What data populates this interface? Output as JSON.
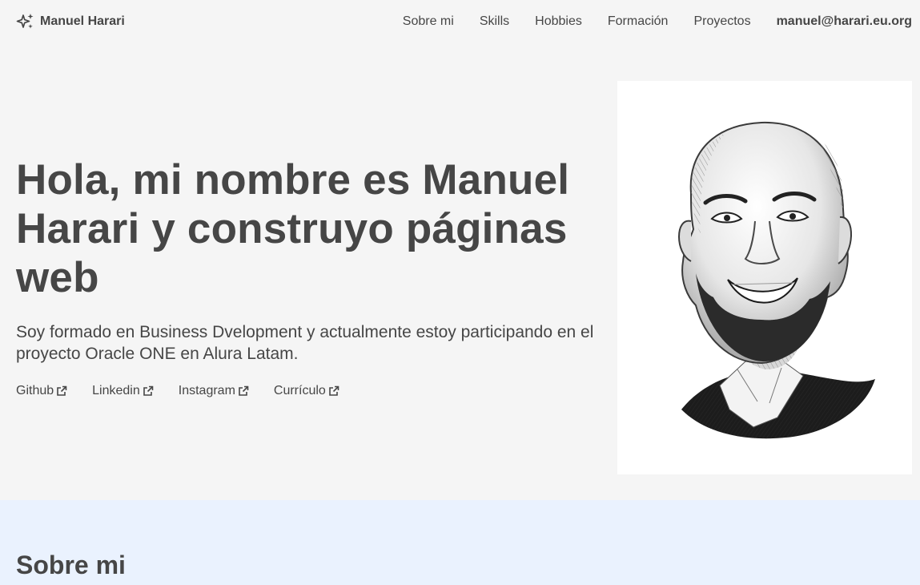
{
  "header": {
    "brand_name": "Manuel Harari",
    "brand_icon": "sparkles-icon",
    "nav": [
      {
        "label": "Sobre mi"
      },
      {
        "label": "Skills"
      },
      {
        "label": "Hobbies"
      },
      {
        "label": "Formación"
      },
      {
        "label": "Proyectos"
      }
    ],
    "email": "manuel@harari.eu.org"
  },
  "hero": {
    "title": "Hola, mi nombre es Manuel Harari y construyo páginas web",
    "lead": "Soy formado en Business Dvelopment y actualmente estoy participando en el proyecto Oracle ONE en Alura Latam.",
    "links": [
      {
        "label": "Github",
        "icon": "external-link-icon"
      },
      {
        "label": "Linkedin",
        "icon": "external-link-icon"
      },
      {
        "label": "Instagram",
        "icon": "external-link-icon"
      },
      {
        "label": "Currículo",
        "icon": "external-link-icon"
      }
    ],
    "portrait": "pencil-sketch-portrait"
  },
  "about": {
    "heading": "Sobre mi"
  },
  "colors": {
    "text": "#464646",
    "page_bg": "#f5f5f5",
    "about_bg": "#eaf2fe",
    "portrait_bg": "#ffffff"
  }
}
